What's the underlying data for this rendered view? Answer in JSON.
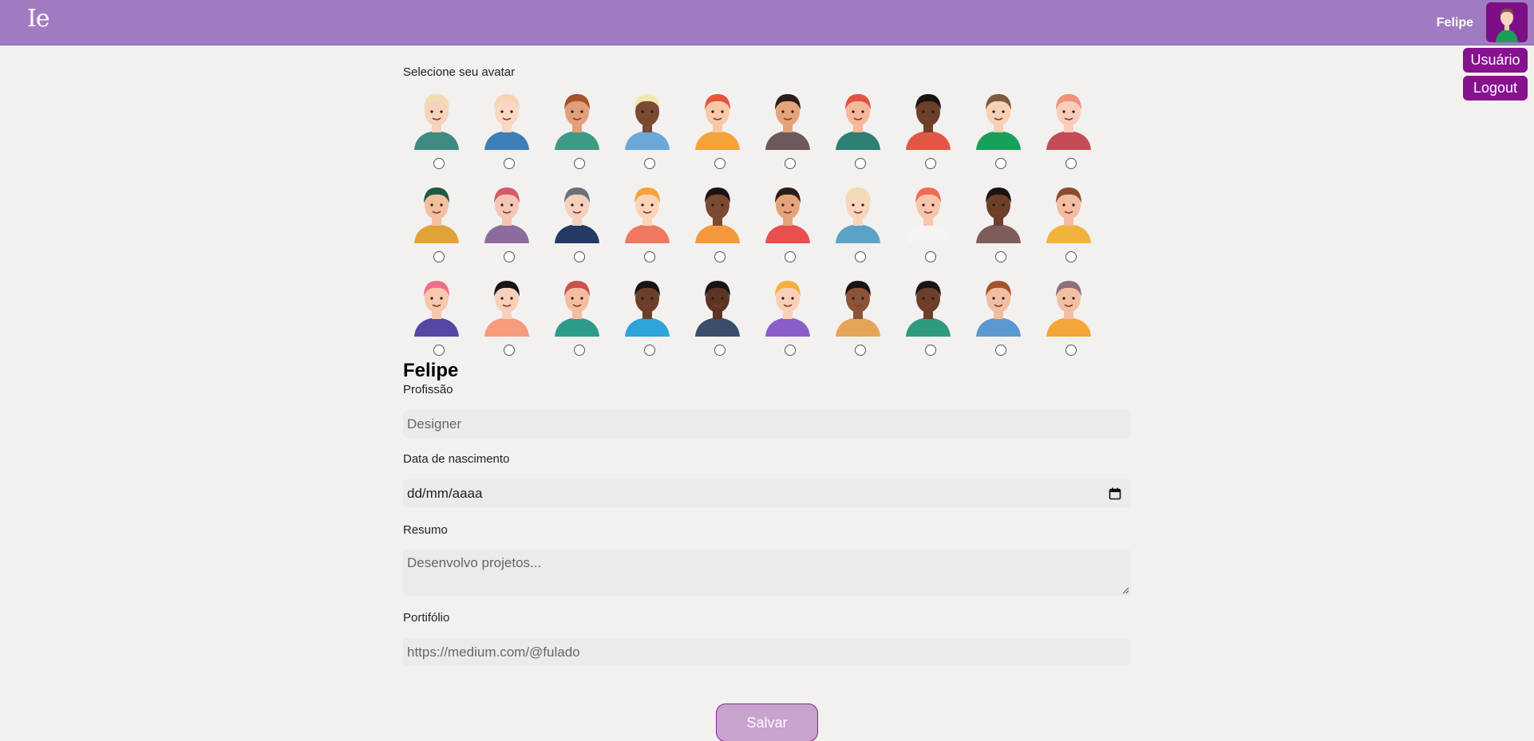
{
  "header": {
    "logo": "Ie",
    "user_name": "Felipe",
    "menu": {
      "usuario_label": "Usuário",
      "logout_label": "Logout"
    }
  },
  "avatar_picker": {
    "label": "Selecione seu avatar",
    "avatars": [
      {
        "skin": "#f6d3bb",
        "hair": "#f1dcb4",
        "shirt": "#3d8b83"
      },
      {
        "skin": "#fbd8c3",
        "hair": "#f6d4b4",
        "shirt": "#3d7fb7"
      },
      {
        "skin": "#e39e7b",
        "hair": "#a3532d",
        "shirt": "#3e9a84"
      },
      {
        "skin": "#7a4a33",
        "hair": "#f4e6b0",
        "shirt": "#6ba8d8"
      },
      {
        "skin": "#f8c9a8",
        "hair": "#e4553a",
        "shirt": "#f3a43a"
      },
      {
        "skin": "#e4a479",
        "hair": "#2c1d18",
        "shirt": "#6c5a5a"
      },
      {
        "skin": "#f5b899",
        "hair": "#e4513e",
        "shirt": "#2e7f74"
      },
      {
        "skin": "#6b3f2a",
        "hair": "#1a1313",
        "shirt": "#e25744"
      },
      {
        "skin": "#f7d1b5",
        "hair": "#7b5a3d",
        "shirt": "#16a05a"
      },
      {
        "skin": "#f9cdbc",
        "hair": "#f19179",
        "shirt": "#c44d55"
      },
      {
        "skin": "#f2c0a1",
        "hair": "#1d5a3f",
        "shirt": "#e1a238"
      },
      {
        "skin": "#f4c6b5",
        "hair": "#d45c69",
        "shirt": "#8d6b9c"
      },
      {
        "skin": "#f4d0bd",
        "hair": "#6c6f78",
        "shirt": "#233a63"
      },
      {
        "skin": "#fbd4b8",
        "hair": "#f2a43c",
        "shirt": "#f07862"
      },
      {
        "skin": "#7a4a33",
        "hair": "#1a1313",
        "shirt": "#f29a3b"
      },
      {
        "skin": "#e4a479",
        "hair": "#2c1d18",
        "shirt": "#e94f4b"
      },
      {
        "skin": "#f7d6be",
        "hair": "#f1dcb4",
        "shirt": "#5aa3c7"
      },
      {
        "skin": "#f8c5ad",
        "hair": "#ef6b53",
        "shirt": "#f4f4f4"
      },
      {
        "skin": "#6b3f2a",
        "hair": "#1a1313",
        "shirt": "#7d5c5c"
      },
      {
        "skin": "#f3bda1",
        "hair": "#8b4b2e",
        "shirt": "#f2b33d"
      },
      {
        "skin": "#f8c7ad",
        "hair": "#ef6f8a",
        "shirt": "#5547a3"
      },
      {
        "skin": "#f8d0bb",
        "hair": "#1b1415",
        "shirt": "#f49c7b"
      },
      {
        "skin": "#f3bda1",
        "hair": "#c9524f",
        "shirt": "#2e9b8a"
      },
      {
        "skin": "#6b3f2a",
        "hair": "#1a1313",
        "shirt": "#2fa4d8"
      },
      {
        "skin": "#5b3425",
        "hair": "#1a1313",
        "shirt": "#3b4d6a"
      },
      {
        "skin": "#f8d0b8",
        "hair": "#f2b040",
        "shirt": "#8a5ec9"
      },
      {
        "skin": "#8a5438",
        "hair": "#1a1313",
        "shirt": "#e6a35a"
      },
      {
        "skin": "#6b3f2a",
        "hair": "#1a1313",
        "shirt": "#2e9b7e"
      },
      {
        "skin": "#f3bda1",
        "hair": "#a3532d",
        "shirt": "#5b98d1"
      },
      {
        "skin": "#f2c0a1",
        "hair": "#8d7178",
        "shirt": "#f3a63a"
      }
    ]
  },
  "profile": {
    "name": "Felipe",
    "profession": {
      "label": "Profissão",
      "placeholder": "Designer"
    },
    "birthdate": {
      "label": "Data de nascimento",
      "placeholder": "dd/mm/aaaa"
    },
    "summary": {
      "label": "Resumo",
      "placeholder": "Desenvolvo projetos..."
    },
    "portfolio": {
      "label": "Portifólio",
      "placeholder": "https://medium.com/@fulado"
    },
    "save_label": "Salvar"
  },
  "colors": {
    "topbar": "#a17bc1",
    "accent": "#86128d",
    "background": "#f3f1ef",
    "save_button": "#c7a3ce"
  }
}
